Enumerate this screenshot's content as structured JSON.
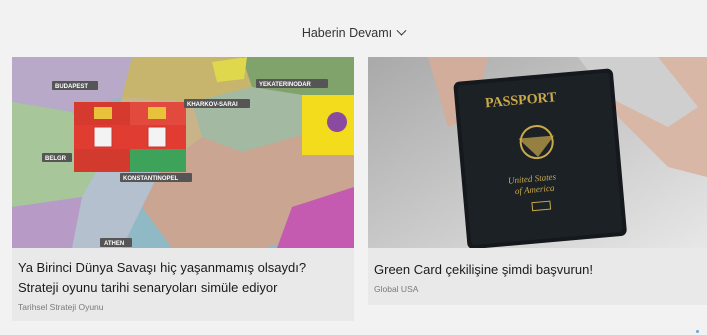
{
  "more_link": {
    "label": "Haberin Devamı",
    "icon": "chevron-down-icon"
  },
  "cards": [
    {
      "title": "Ya Birinci Dünya Savaşı hiç yaşanmamış olsaydı? Strateji oyunu tarihi senaryoları simüle ediyor",
      "source": "Tarihsel Strateji Oyunu",
      "map_labels": [
        "BUDAPEST",
        "YEKATERINODAR",
        "KHARKOV-SARAI",
        "BELGR",
        "KONSTANTINOPEL",
        "ATHEN"
      ]
    },
    {
      "title": "Green Card çekilişine şimdi başvurun!",
      "source": "Global USA",
      "passport_texts": [
        "PASSPORT",
        "United States",
        "of America"
      ]
    }
  ],
  "colors": {
    "background": "#f2f2f2",
    "card": "#e9e9e9",
    "text": "#1b1b1b",
    "muted": "#7a7a7a"
  }
}
